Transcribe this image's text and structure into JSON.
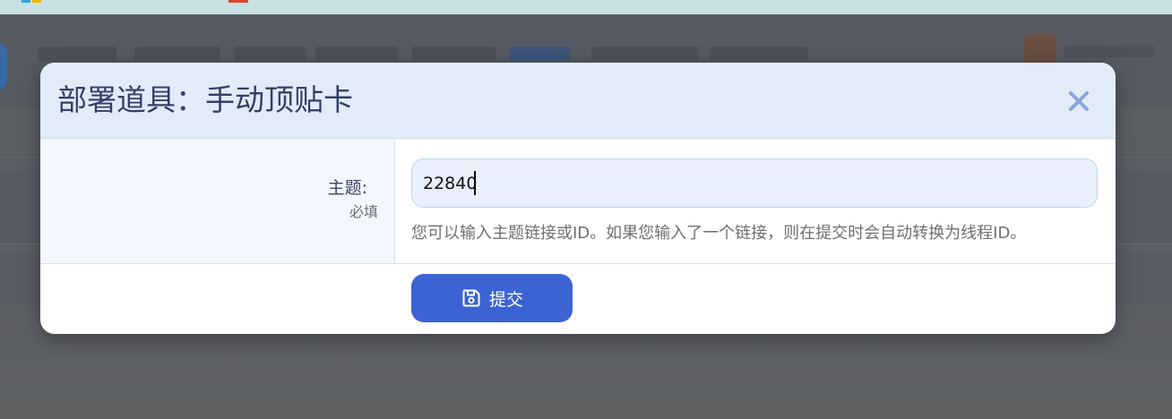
{
  "modal": {
    "title": "部署道具：手动顶贴卡",
    "close_icon": "close-icon",
    "form": {
      "topic_label": "主题:",
      "required_note": "必填",
      "topic_value": "22840",
      "help_text": "您可以输入主题链接或ID。如果您输入了一个链接，则在提交时会自动转换为线程ID。"
    },
    "submit": {
      "label": "提交",
      "icon": "save-icon"
    }
  },
  "colors": {
    "header_bg": "#e1ecf8",
    "title": "#33406b",
    "accent": "#3b63d3",
    "overlay": "#5b5e62"
  }
}
